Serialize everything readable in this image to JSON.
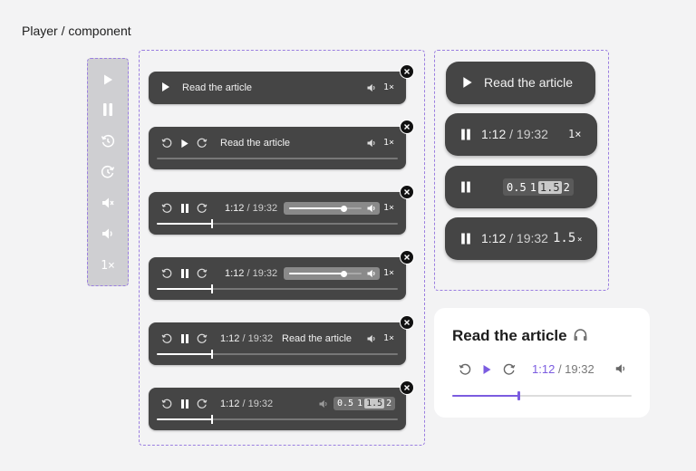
{
  "page_title": "Player / component",
  "article_label": "Read the article",
  "time_current": "1:12",
  "time_total": "/ 19:32",
  "speed_label": "1×",
  "speed_options": [
    "0.5",
    "1",
    "1.5",
    "2"
  ],
  "speed_selected": "1.5",
  "playback_progress": 0.23,
  "volume_level": 0.75,
  "card": {
    "title": "Read the article",
    "current": "1:12",
    "total": "/ 19:32",
    "progress": 0.37
  },
  "colors": {
    "accent": "#7b5ce0",
    "bar": "#454545",
    "dash": "#9b7fe0"
  },
  "icons": [
    "play-icon",
    "pause-icon",
    "rewind-icon",
    "forward-icon",
    "mute-icon",
    "volume-icon",
    "headphones-icon",
    "close-icon"
  ]
}
